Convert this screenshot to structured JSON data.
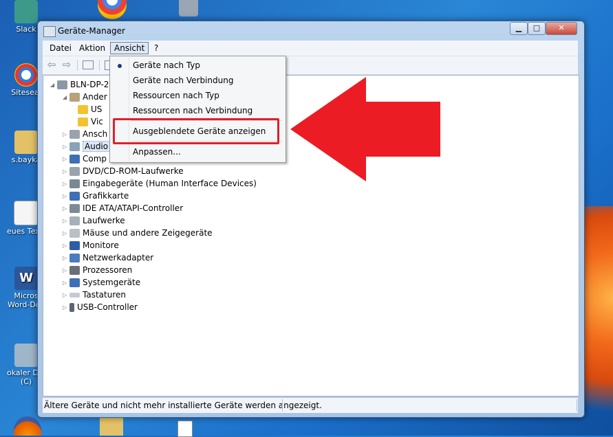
{
  "desktop": {
    "icons": [
      {
        "label": "Slack",
        "color": "#3d9a8a"
      },
      {
        "label": "Siteseal",
        "color": "#2b7fd9"
      },
      {
        "label": "s.bayka",
        "color": "#e3c267"
      },
      {
        "label": "eues Textdo",
        "color": "#f5f5f5"
      },
      {
        "label": "Micros",
        "label2": "Word-Dok",
        "color": "#2b579a"
      },
      {
        "label": "okaler Date",
        "label2": "(C)",
        "color": "#9fb6c9"
      }
    ]
  },
  "window": {
    "title": "Geräte-Manager",
    "controls": {
      "minimize": "▁",
      "maximize": "□",
      "close": "✕"
    }
  },
  "menubar": {
    "items": [
      {
        "label": "Datei"
      },
      {
        "label": "Aktion"
      },
      {
        "label": "Ansicht"
      },
      {
        "label": "?"
      }
    ]
  },
  "toolbar": {
    "back": "⇦",
    "forward": "⇨"
  },
  "tree": {
    "root": "BLN-DP-2",
    "nodes": [
      {
        "label": "Ander",
        "state": "expanded"
      },
      {
        "label": "US",
        "warn": true
      },
      {
        "label": "Vic",
        "warn": true
      },
      {
        "label": "Ansch"
      },
      {
        "label": "Audio"
      },
      {
        "label": "Comp"
      },
      {
        "label": "DVD/CD-ROM-Laufwerke"
      },
      {
        "label": "Eingabegeräte (Human Interface Devices)"
      },
      {
        "label": "Grafikkarte"
      },
      {
        "label": "IDE ATA/ATAPI-Controller"
      },
      {
        "label": "Laufwerke"
      },
      {
        "label": "Mäuse und andere Zeigegeräte"
      },
      {
        "label": "Monitore"
      },
      {
        "label": "Netzwerkadapter"
      },
      {
        "label": "Prozessoren"
      },
      {
        "label": "Systemgeräte"
      },
      {
        "label": "Tastaturen"
      },
      {
        "label": "USB-Controller"
      }
    ]
  },
  "dropdown": {
    "items": [
      {
        "label": "Geräte nach Typ",
        "checked": true
      },
      {
        "label": "Geräte nach Verbindung"
      },
      {
        "label": "Ressourcen nach Typ"
      },
      {
        "label": "Ressourcen nach Verbindung"
      },
      {
        "label": "Ausgeblendete Geräte anzeigen"
      },
      {
        "label": "Anpassen..."
      }
    ]
  },
  "status": {
    "text": "Ältere Geräte und nicht mehr installierte Geräte werden angezeigt."
  },
  "annotation": {
    "highlight_color": "#e0202a",
    "arrow_color": "#ec1c24"
  }
}
